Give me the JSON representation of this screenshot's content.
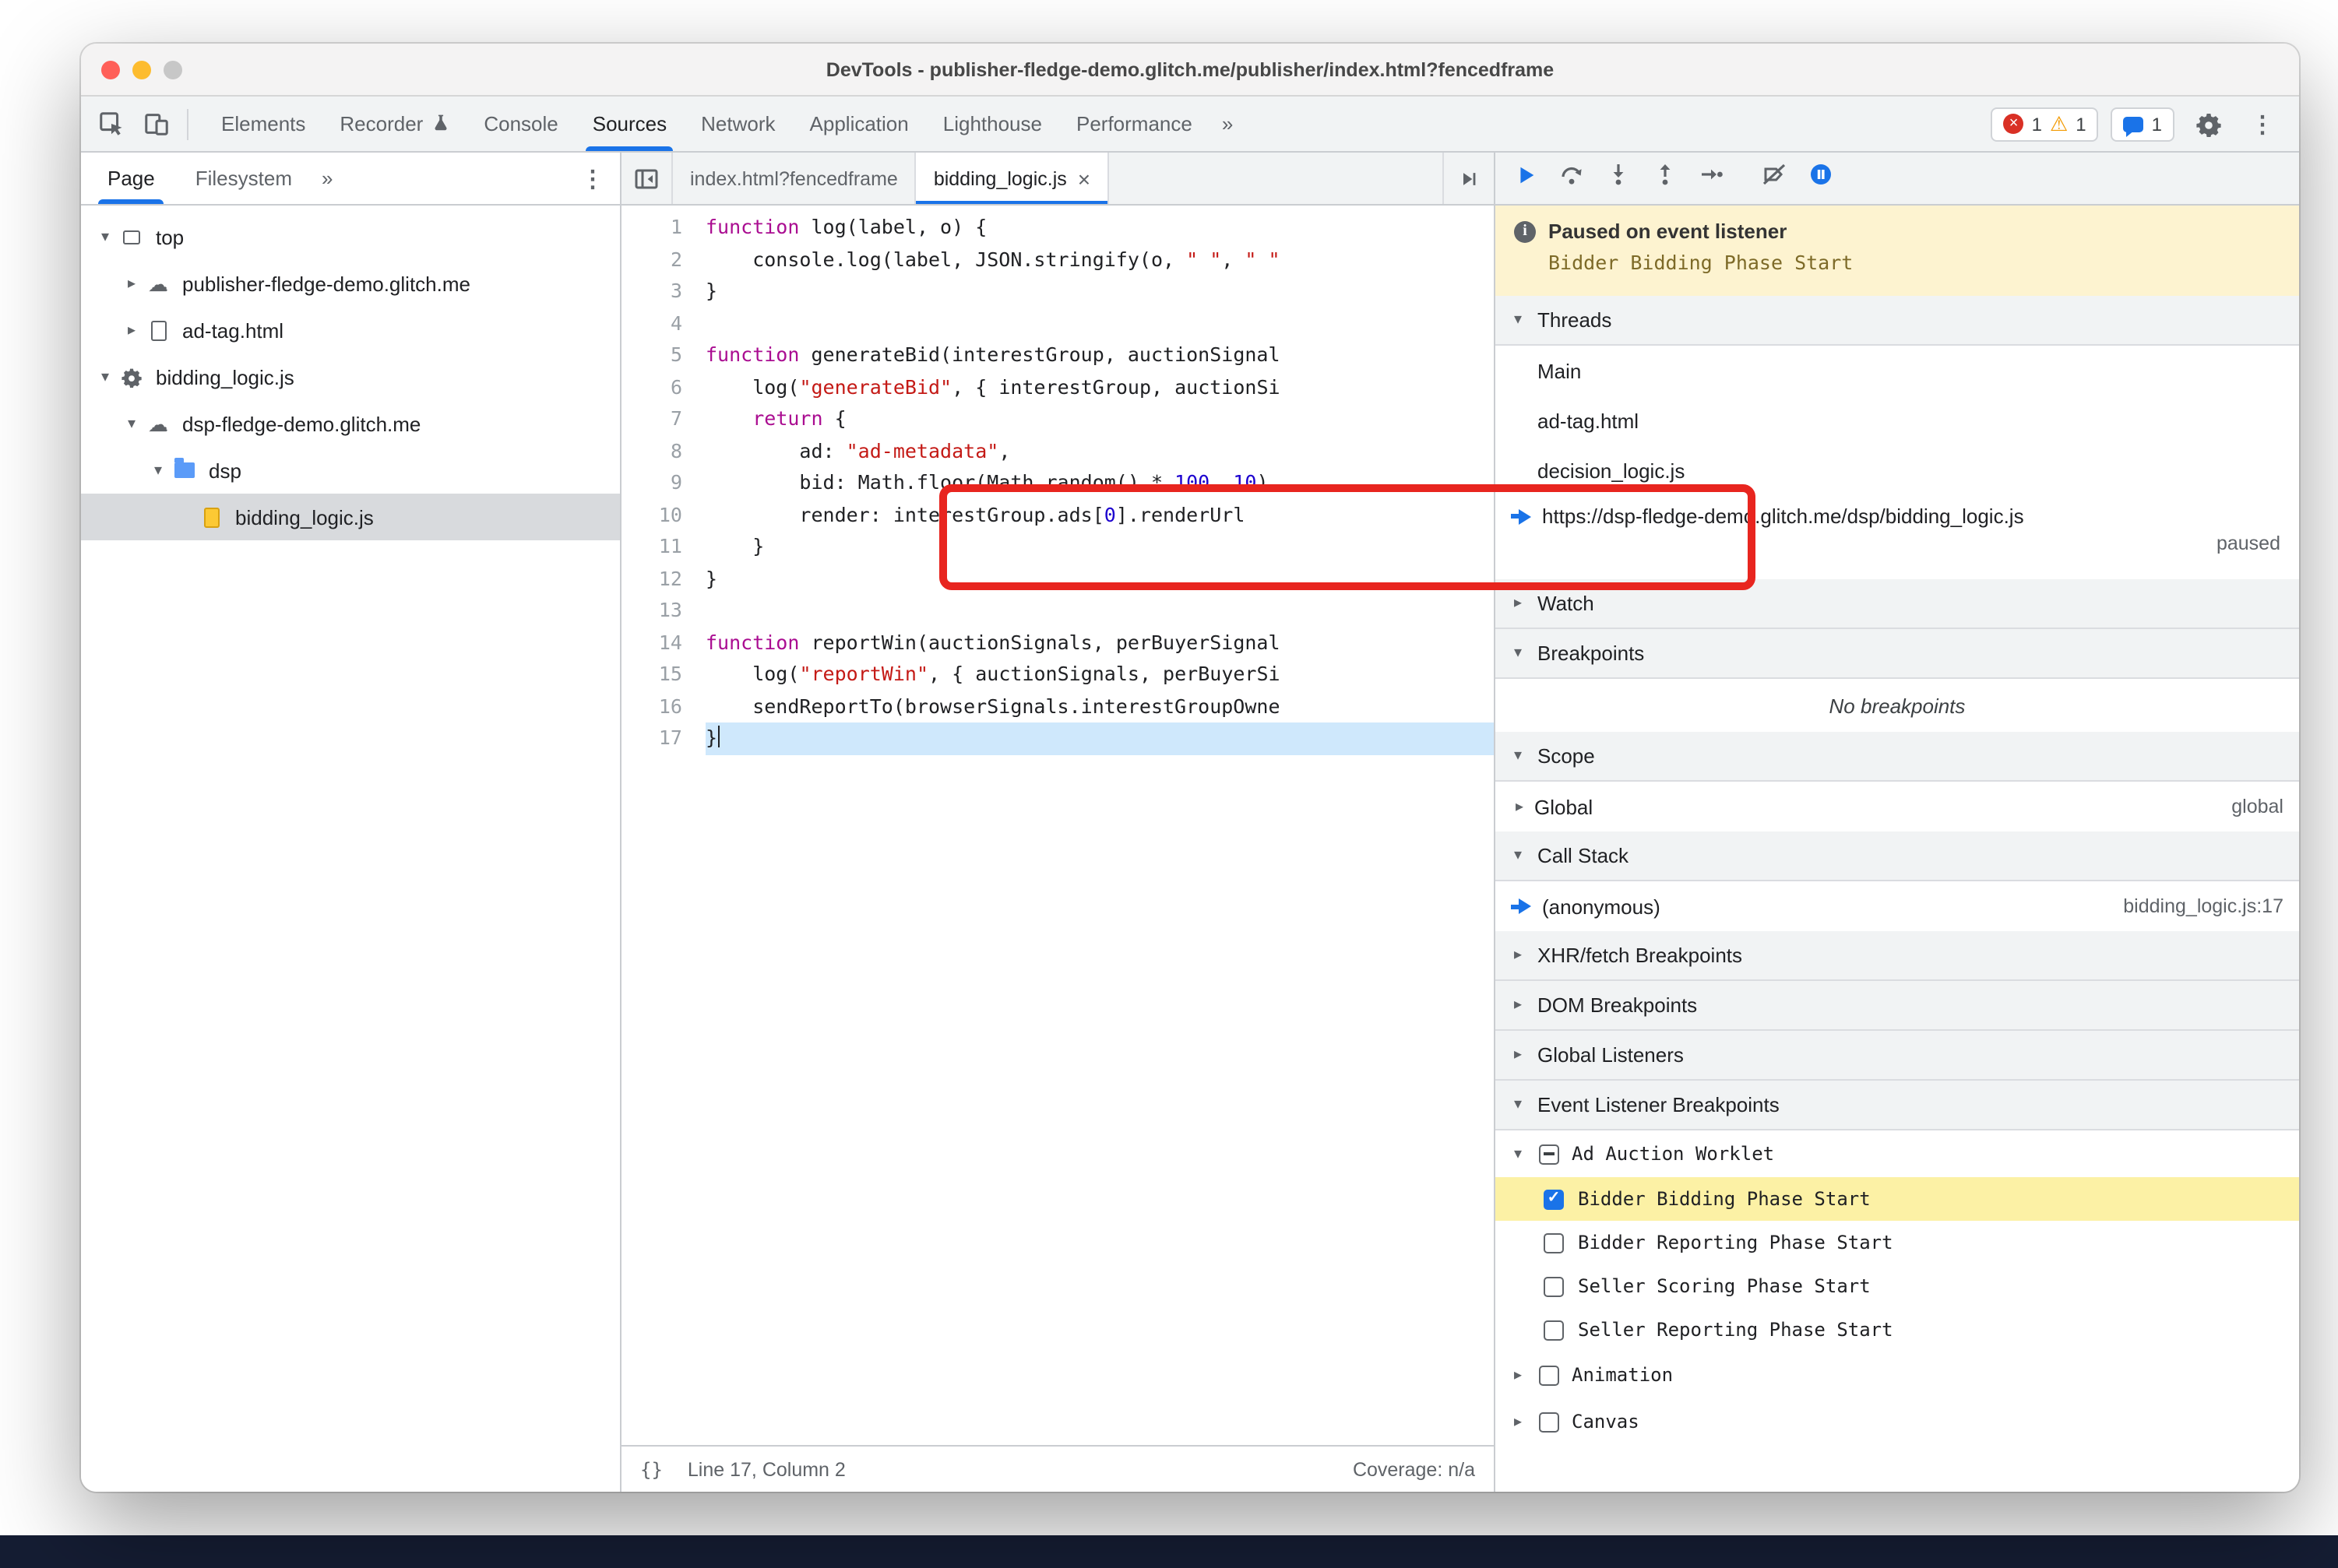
{
  "window": {
    "title": "DevTools - publisher-fledge-demo.glitch.me/publisher/index.html?fencedframe"
  },
  "chrome_toolbar": {
    "tabs": [
      "Elements",
      "Recorder",
      "Console",
      "Sources",
      "Network",
      "Application",
      "Lighthouse",
      "Performance"
    ],
    "selected_tab": "Sources",
    "overflow": "»",
    "error_count": "1",
    "warning_count": "1",
    "issues_count": "1"
  },
  "navigator": {
    "tabs": [
      "Page",
      "Filesystem"
    ],
    "selected_tab": "Page",
    "overflow": "»",
    "tree": [
      {
        "label": "top",
        "icon": "frame",
        "depth": 0,
        "caret": "open"
      },
      {
        "label": "publisher-fledge-demo.glitch.me",
        "icon": "cloud",
        "depth": 1,
        "caret": "closed"
      },
      {
        "label": "ad-tag.html",
        "icon": "doc",
        "depth": 1,
        "caret": "closed"
      },
      {
        "label": "bidding_logic.js",
        "icon": "gear",
        "depth": 0,
        "caret": "open"
      },
      {
        "label": "dsp-fledge-demo.glitch.me",
        "icon": "cloud",
        "depth": 1,
        "caret": "open"
      },
      {
        "label": "dsp",
        "icon": "folder",
        "depth": 2,
        "caret": "open"
      },
      {
        "label": "bidding_logic.js",
        "icon": "file",
        "depth": 3,
        "caret": "none",
        "selected": true
      }
    ]
  },
  "editor": {
    "tabs": [
      {
        "label": "index.html?fencedframe",
        "active": false,
        "close": ""
      },
      {
        "label": "bidding_logic.js",
        "active": true,
        "close": "×"
      }
    ],
    "lines": [
      {
        "n": 1,
        "toks": [
          [
            "k",
            "function"
          ],
          [
            "t",
            " log(label, o) {"
          ]
        ]
      },
      {
        "n": 2,
        "toks": [
          [
            "t",
            "    console.log(label, JSON.stringify(o, "
          ],
          [
            "s",
            "\" \""
          ],
          [
            "t",
            ", "
          ],
          [
            "s",
            "\" \""
          ]
        ]
      },
      {
        "n": 3,
        "toks": [
          [
            "t",
            "}"
          ]
        ]
      },
      {
        "n": 4,
        "toks": []
      },
      {
        "n": 5,
        "toks": [
          [
            "k",
            "function"
          ],
          [
            "t",
            " generateBid(interestGroup, auctionSignal"
          ]
        ]
      },
      {
        "n": 6,
        "toks": [
          [
            "t",
            "    log("
          ],
          [
            "s",
            "\"generateBid\""
          ],
          [
            "t",
            ", { interestGroup, auctionSi"
          ]
        ]
      },
      {
        "n": 7,
        "toks": [
          [
            "t",
            "    "
          ],
          [
            "k",
            "return"
          ],
          [
            "t",
            " {"
          ]
        ]
      },
      {
        "n": 8,
        "toks": [
          [
            "t",
            "        ad: "
          ],
          [
            "s",
            "\"ad-metadata\""
          ],
          [
            "t",
            ","
          ]
        ]
      },
      {
        "n": 9,
        "toks": [
          [
            "t",
            "        bid: Math.floor(Math.random() * "
          ],
          [
            "n",
            "100"
          ],
          [
            "t",
            ", "
          ],
          [
            "n",
            "10"
          ],
          [
            "t",
            "),"
          ]
        ]
      },
      {
        "n": 10,
        "toks": [
          [
            "t",
            "        render: interestGroup.ads["
          ],
          [
            "n",
            "0"
          ],
          [
            "t",
            "].renderUrl"
          ]
        ]
      },
      {
        "n": 11,
        "toks": [
          [
            "t",
            "    }"
          ]
        ]
      },
      {
        "n": 12,
        "toks": [
          [
            "t",
            "}"
          ]
        ]
      },
      {
        "n": 13,
        "toks": []
      },
      {
        "n": 14,
        "toks": [
          [
            "k",
            "function"
          ],
          [
            "t",
            " reportWin(auctionSignals, perBuyerSignal"
          ]
        ]
      },
      {
        "n": 15,
        "toks": [
          [
            "t",
            "    log("
          ],
          [
            "s",
            "\"reportWin\""
          ],
          [
            "t",
            ", { auctionSignals, perBuyerSi"
          ]
        ]
      },
      {
        "n": 16,
        "toks": [
          [
            "t",
            "    sendReportTo(browserSignals.interestGroupOwne"
          ]
        ]
      },
      {
        "n": 17,
        "toks": [
          [
            "t",
            "}"
          ]
        ],
        "exec": true
      }
    ],
    "status": {
      "pretty_print": "{}",
      "position": "Line 17, Column 2",
      "coverage": "Coverage: n/a"
    }
  },
  "debugger": {
    "banner": {
      "title": "Paused on event listener",
      "subtitle": "Bidder Bidding Phase Start"
    },
    "threads": {
      "title": "Threads",
      "items": [
        "Main",
        "ad-tag.html",
        "decision_logic.js"
      ],
      "active": {
        "url": "https://dsp-fledge-demo.glitch.me/dsp/bidding_logic.js",
        "status": "paused"
      }
    },
    "watch_title": "Watch",
    "breakpoints": {
      "title": "Breakpoints",
      "empty": "No breakpoints"
    },
    "scope": {
      "title": "Scope",
      "row_label": "Global",
      "row_value": "global"
    },
    "call_stack": {
      "title": "Call Stack",
      "frame": "(anonymous)",
      "location": "bidding_logic.js:17"
    },
    "collapsed_sections": [
      "XHR/fetch Breakpoints",
      "DOM Breakpoints",
      "Global Listeners"
    ],
    "event_listeners": {
      "title": "Event Listener Breakpoints",
      "groups": [
        {
          "label": "Ad Auction Worklet",
          "state": "indeterminate",
          "caret": "open",
          "children": [
            {
              "label": "Bidder Bidding Phase Start",
              "checked": true,
              "highlighted": true
            },
            {
              "label": "Bidder Reporting Phase Start",
              "checked": false
            },
            {
              "label": "Seller Scoring Phase Start",
              "checked": false
            },
            {
              "label": "Seller Reporting Phase Start",
              "checked": false
            }
          ]
        },
        {
          "label": "Animation",
          "state": "unchecked",
          "caret": "closed",
          "children": []
        },
        {
          "label": "Canvas",
          "state": "unchecked",
          "caret": "closed",
          "children": []
        }
      ]
    }
  }
}
